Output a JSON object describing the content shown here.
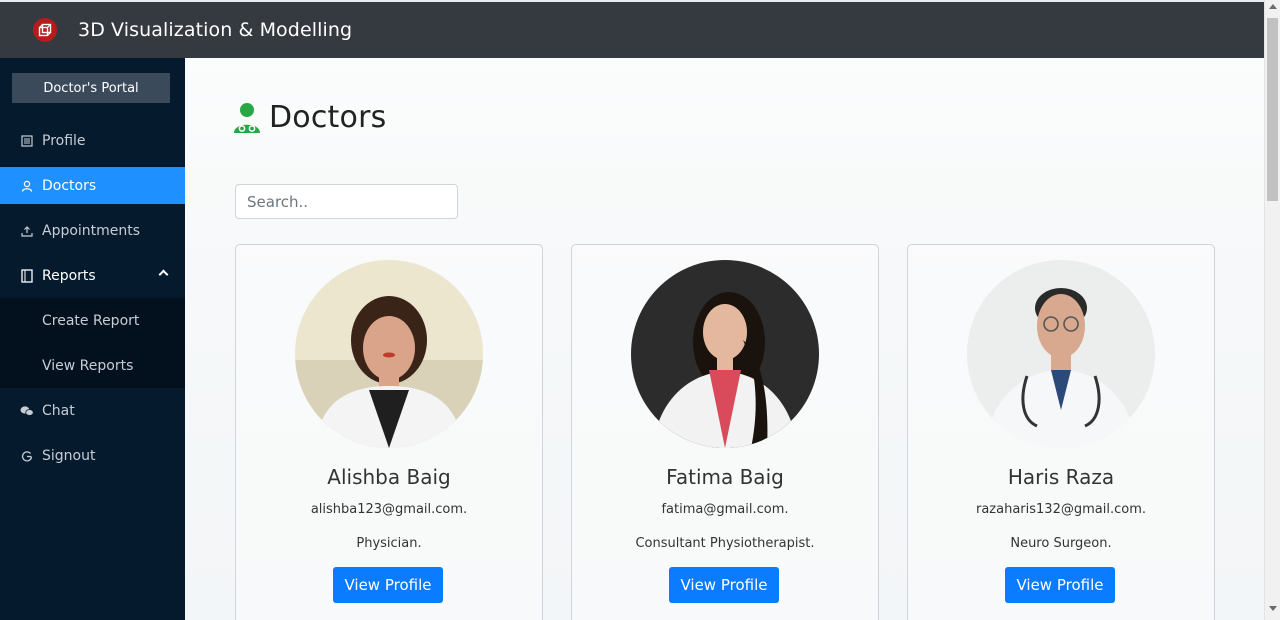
{
  "app": {
    "title": "3D Visualization & Modelling",
    "logo_icon": "cube-icon",
    "accent_color": "#1e90ff"
  },
  "sidebar": {
    "portal_label": "Doctor's Portal",
    "items": [
      {
        "label": "Profile",
        "icon": "list-icon",
        "active": false
      },
      {
        "label": "Doctors",
        "icon": "user-icon",
        "active": true
      },
      {
        "label": "Appointments",
        "icon": "upload-icon",
        "active": false
      },
      {
        "label": "Reports",
        "icon": "document-icon",
        "active": false,
        "expanded": true,
        "children": [
          {
            "label": "Create Report"
          },
          {
            "label": "View Reports"
          }
        ]
      },
      {
        "label": "Chat",
        "icon": "chat-icon",
        "active": false
      },
      {
        "label": "Signout",
        "icon": "power-icon",
        "active": false
      }
    ]
  },
  "main": {
    "page_title": "Doctors",
    "page_title_icon": "doctor-icon",
    "search": {
      "placeholder": "Search..",
      "value": ""
    },
    "doctors": [
      {
        "name": "Alishba Baig",
        "email": "alishba123@gmail.com.",
        "specialty": "Physician.",
        "button_label": "View Profile"
      },
      {
        "name": "Fatima Baig",
        "email": "fatima@gmail.com.",
        "specialty": "Consultant Physiotherapist.",
        "button_label": "View Profile"
      },
      {
        "name": "Haris Raza",
        "email": "razaharis132@gmail.com.",
        "specialty": "Neuro Surgeon.",
        "button_label": "View Profile"
      }
    ]
  }
}
